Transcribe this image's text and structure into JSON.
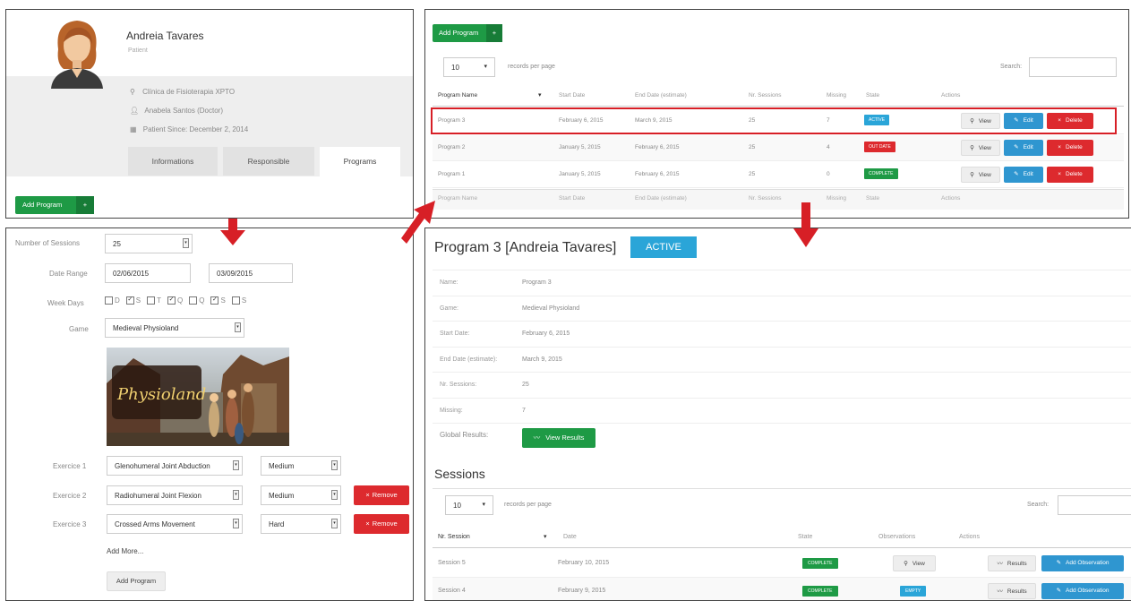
{
  "profile": {
    "name": "Andreia Tavares",
    "role": "Patient",
    "clinic": "Clínica de Fisioterapia XPTO",
    "doctor": "Anabela Santos (Doctor)",
    "since": "Patient Since: December 2, 2014",
    "tabs": [
      "Informations",
      "Responsible",
      "Programs"
    ],
    "add_program": "Add Program",
    "plus": "+"
  },
  "form": {
    "sessions_label": "Number of Sessions",
    "sessions_value": "25",
    "range_label": "Date Range",
    "date_start": "02/06/2015",
    "date_end": "03/09/2015",
    "weekdays_label": "Week Days",
    "weekdays": [
      {
        "letter": "D",
        "checked": false
      },
      {
        "letter": "S",
        "checked": true
      },
      {
        "letter": "T",
        "checked": false
      },
      {
        "letter": "Q",
        "checked": true
      },
      {
        "letter": "Q",
        "checked": false
      },
      {
        "letter": "S",
        "checked": true
      },
      {
        "letter": "S",
        "checked": false
      }
    ],
    "game_label": "Game",
    "game_value": "Medieval Physioland",
    "game_logo": "Physioland",
    "exercises": [
      {
        "label": "Exercice 1",
        "name": "Glenohumeral Joint Abduction",
        "level": "Medium",
        "remove": ""
      },
      {
        "label": "Exercice 2",
        "name": "Radiohumeral Joint Flexion",
        "level": "Medium",
        "remove": "Remove"
      },
      {
        "label": "Exercice 3",
        "name": "Crossed Arms Movement",
        "level": "Hard",
        "remove": "Remove"
      }
    ],
    "add_more": "Add More...",
    "submit": "Add Program"
  },
  "programs": {
    "add_program": "Add Program",
    "plus": "+",
    "per_page_value": "10",
    "per_page_label": "records per page",
    "search_label": "Search:",
    "columns": [
      "Program Name",
      "Start Date",
      "End Date (estimate)",
      "Nr. Sessions",
      "Missing",
      "State",
      "Actions"
    ],
    "rows": [
      {
        "name": "Program 3",
        "start": "February 6, 2015",
        "end": "March 9, 2015",
        "sessions": "25",
        "missing": "7",
        "state": "ACTIVE",
        "color": "#2aa5d8"
      },
      {
        "name": "Program 2",
        "start": "January 5, 2015",
        "end": "February 6, 2015",
        "sessions": "25",
        "missing": "4",
        "state": "OUT DATE",
        "color": "#dd2a2e"
      },
      {
        "name": "Program 1",
        "start": "January 5, 2015",
        "end": "February 6, 2015",
        "sessions": "25",
        "missing": "0",
        "state": "COMPLETE",
        "color": "#1e9a45"
      }
    ],
    "view": "View",
    "edit": "Edit",
    "delete": "Delete"
  },
  "detail": {
    "title": "Program 3 [Andreia Tavares]",
    "badge": "ACTIVE",
    "fields": [
      {
        "label": "Name:",
        "value": "Program 3"
      },
      {
        "label": "Game:",
        "value": "Medieval Physioland"
      },
      {
        "label": "Start Date:",
        "value": "February 6, 2015"
      },
      {
        "label": "End Date (estimate):",
        "value": "March 9, 2015"
      },
      {
        "label": "Nr. Sessions:",
        "value": "25"
      },
      {
        "label": "Missing:",
        "value": "7"
      }
    ],
    "global_label": "Global Results:",
    "view_results": "View Results"
  },
  "sessions": {
    "title": "Sessions",
    "per_page_value": "10",
    "per_page_label": "records per page",
    "search_label": "Search:",
    "columns": [
      "Nr. Session",
      "Date",
      "State",
      "Observations",
      "Actions"
    ],
    "rows": [
      {
        "name": "Session 5",
        "date": "February 10, 2015",
        "state": "COMPLETE",
        "obs": "View",
        "obs_type": "view"
      },
      {
        "name": "Session 4",
        "date": "February 9, 2015",
        "state": "COMPLETE",
        "obs": "EMPTY",
        "obs_type": "empty"
      }
    ],
    "results": "Results",
    "add_obs": "Add Observation"
  },
  "colors": {
    "green": "#1e9a45",
    "blue": "#2f96d0",
    "red": "#dd2a2e",
    "arrow": "#d71f26"
  }
}
